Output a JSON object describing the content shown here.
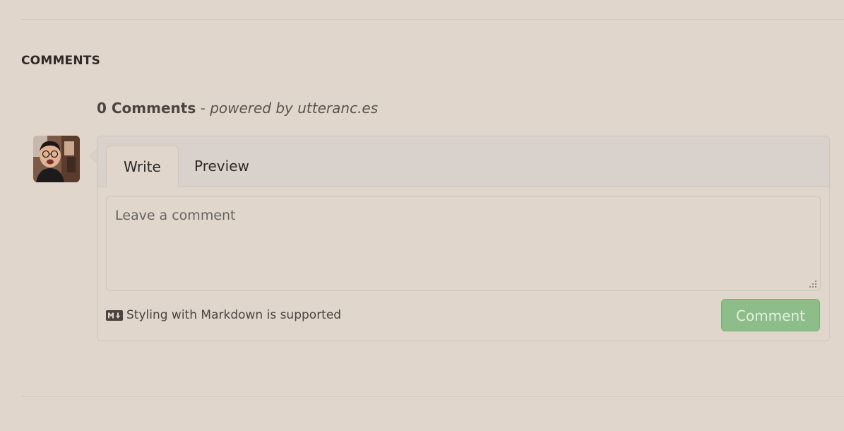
{
  "section": {
    "heading": "COMMENTS"
  },
  "comments": {
    "count_label": "0 Comments",
    "separator": " - ",
    "powered_by": "powered by utteranc.es"
  },
  "editor": {
    "tabs": [
      {
        "label": "Write",
        "active": true
      },
      {
        "label": "Preview",
        "active": false
      }
    ],
    "textarea": {
      "placeholder": "Leave a comment",
      "value": ""
    },
    "markdown_hint": "Styling with Markdown is supported",
    "markdown_icon": "markdown-icon",
    "submit_label": "Comment",
    "submit_color": "#8dbd89"
  }
}
